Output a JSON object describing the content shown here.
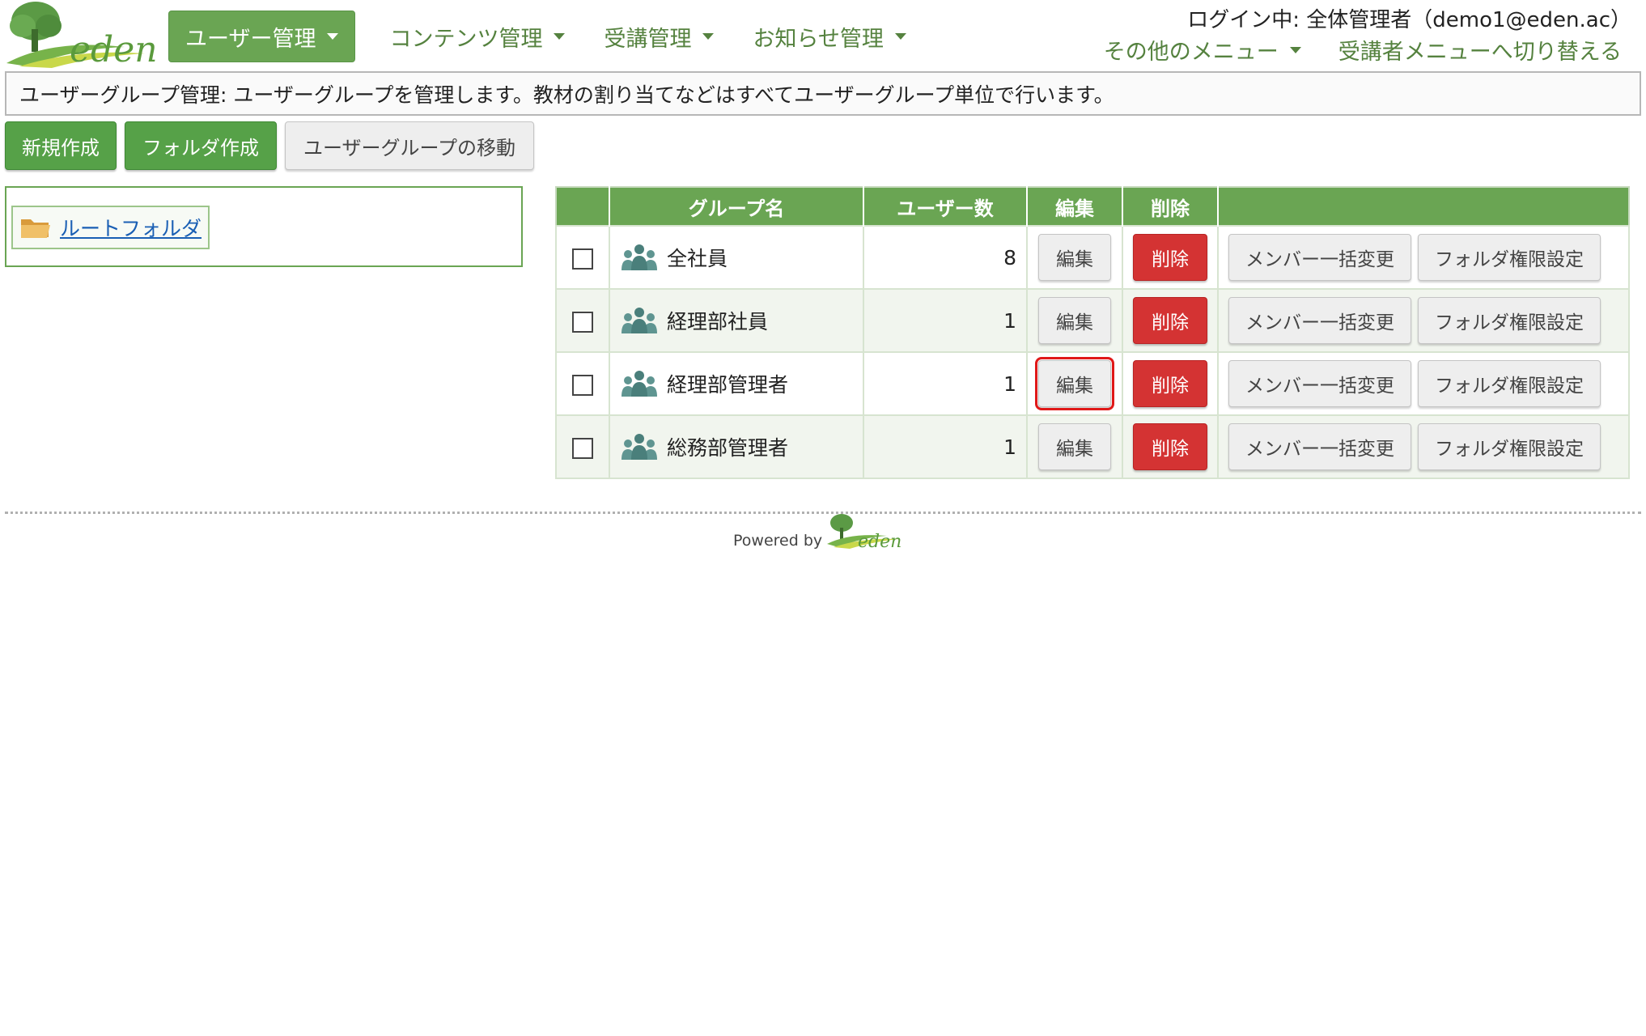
{
  "brand": {
    "name": "eden",
    "primary_color": "#6aa553",
    "danger_color": "#d43333"
  },
  "nav": {
    "items": [
      {
        "label": "ユーザー管理",
        "active": true
      },
      {
        "label": "コンテンツ管理",
        "active": false
      },
      {
        "label": "受講管理",
        "active": false
      },
      {
        "label": "お知らせ管理",
        "active": false
      }
    ]
  },
  "header": {
    "login_info": "ログイン中: 全体管理者（demo1@eden.ac）",
    "other_menu": "その他のメニュー",
    "switch_menu": "受講者メニューへ切り替える"
  },
  "description": "ユーザーグループ管理: ユーザーグループを管理します。教材の割り当てなどはすべてユーザーグループ単位で行います。",
  "toolbar": {
    "new_label": "新規作成",
    "folder_label": "フォルダ作成",
    "move_label": "ユーザーグループの移動"
  },
  "tree": {
    "root_label": "ルートフォルダ",
    "root_icon": "folder-icon"
  },
  "table": {
    "headers": {
      "name": "グループ名",
      "count": "ユーザー数",
      "edit": "編集",
      "delete": "削除"
    },
    "button_labels": {
      "edit": "編集",
      "delete": "削除",
      "members": "メンバー一括変更",
      "folder_perm": "フォルダ権限設定"
    },
    "rows": [
      {
        "name": "全社員",
        "count": "8",
        "icon": "group-icon"
      },
      {
        "name": "経理部社員",
        "count": "1",
        "icon": "group-icon"
      },
      {
        "name": "経理部管理者",
        "count": "1",
        "icon": "group-icon",
        "highlighted_edit": true
      },
      {
        "name": "総務部管理者",
        "count": "1",
        "icon": "group-icon"
      }
    ]
  },
  "footer": {
    "powered_by": "Powered by"
  }
}
